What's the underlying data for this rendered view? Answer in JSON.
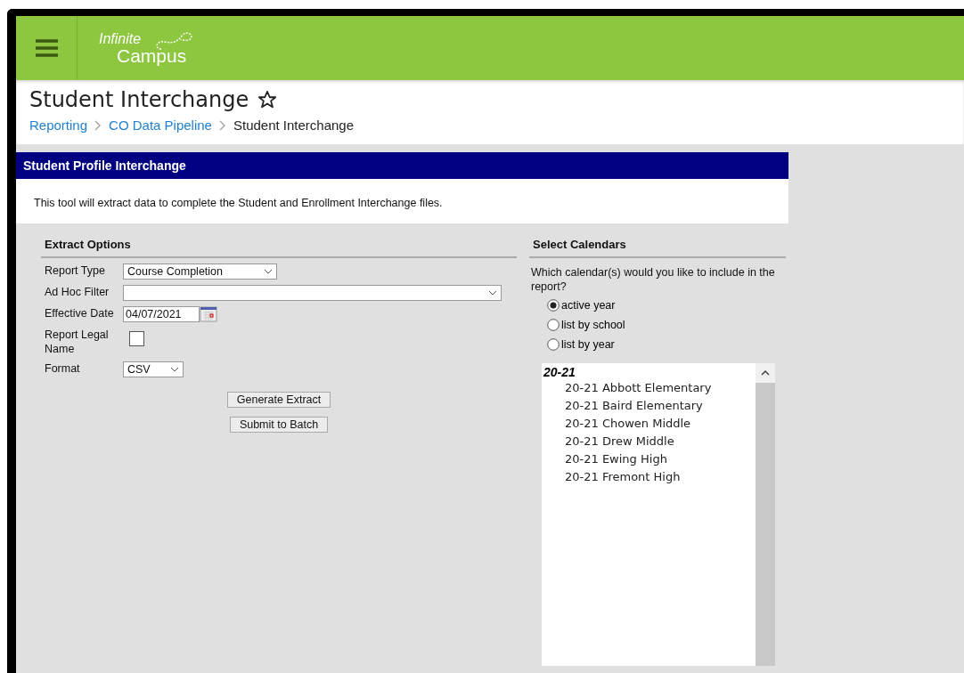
{
  "header": {
    "logo_line_1": "Infinite",
    "logo_line_2": "Campus"
  },
  "page": {
    "title": "Student Interchange",
    "favorite": false,
    "breadcrumbs": [
      {
        "label": "Reporting",
        "link": true
      },
      {
        "label": "CO Data Pipeline",
        "link": true
      },
      {
        "label": "Student Interchange",
        "link": false
      }
    ]
  },
  "panel": {
    "title": "Student Profile Interchange",
    "description": "This tool will extract data to complete the Student and Enrollment Interchange files."
  },
  "extract_options": {
    "heading": "Extract Options",
    "fields": [
      {
        "kind": "select",
        "label": "Report Type",
        "value": "Course Completion"
      },
      {
        "kind": "select",
        "label": "Ad Hoc Filter"
      },
      {
        "kind": "date",
        "label": "Effective Date",
        "value": "04/07/2021"
      },
      {
        "kind": "checkbox",
        "label": "Report Legal Name",
        "checked": false
      },
      {
        "kind": "select",
        "label": "Format",
        "value": "CSV"
      }
    ],
    "buttons": [
      "Generate Extract",
      "Submit to Batch"
    ]
  },
  "select_calendars": {
    "heading": "Select Calendars",
    "question": "Which calendar(s) would you like to include in the report?",
    "options": [
      {
        "label": "active year",
        "selected": true
      },
      {
        "label": "list by school",
        "selected": false
      },
      {
        "label": "list by year",
        "selected": false
      }
    ],
    "calendar_list": [
      {
        "label": "20-21",
        "children": [
          {
            "label": "20-21 Abbott Elementary"
          },
          {
            "label": "20-21 Baird Elementary"
          },
          {
            "label": "20-21 Chowen Middle"
          },
          {
            "label": "20-21 Drew Middle"
          },
          {
            "label": "20-21 Ewing High"
          },
          {
            "label": "20-21 Fremont High"
          }
        ]
      }
    ]
  }
}
